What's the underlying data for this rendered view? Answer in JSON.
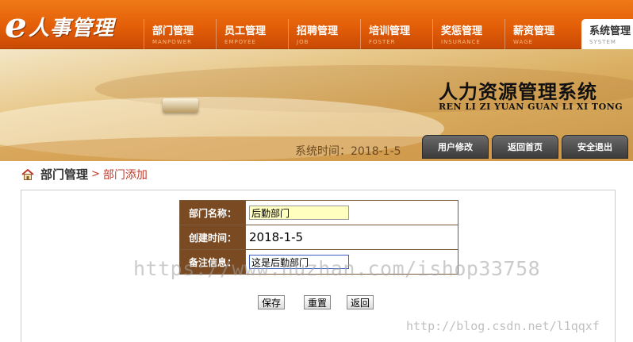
{
  "app": {
    "logo_letter": "e",
    "logo_text": "人事管理",
    "title": "人力资源管理系统",
    "subtitle": "REN LI ZI YUAN GUAN LI XI TONG"
  },
  "nav": [
    {
      "label": "部门管理",
      "sub": "MANPOWER"
    },
    {
      "label": "员工管理",
      "sub": "EMPOYEE"
    },
    {
      "label": "招聘管理",
      "sub": "JOB"
    },
    {
      "label": "培训管理",
      "sub": "FOSTER"
    },
    {
      "label": "奖惩管理",
      "sub": "INSURANCE"
    },
    {
      "label": "薪资管理",
      "sub": "WAGE"
    },
    {
      "label": "系统管理",
      "sub": "SYSTEM",
      "active": true
    }
  ],
  "header": {
    "time_text": "系统时间：2018-1-5",
    "buttons": [
      "用户修改",
      "返回首页",
      "安全退出"
    ]
  },
  "breadcrumb": {
    "section": "部门管理",
    "separator": ">",
    "page": "部门添加"
  },
  "form": {
    "rows": [
      {
        "label": "部门名称：",
        "value": "后勤部门"
      },
      {
        "label": "创建时间：",
        "value": "2018-1-5"
      },
      {
        "label": "备注信息：",
        "value": "这是后勤部门"
      }
    ],
    "buttons": {
      "save": "保存",
      "reset": "重置",
      "back": "返回"
    }
  },
  "watermarks": {
    "main": "https://www.huzhan.com/ishop33758",
    "corner": "http://blog.csdn.net/l1qqxf"
  },
  "colors": {
    "nav_orange": "#e35e08",
    "label_brown": "#7a4a22",
    "accent_red": "#c0392b"
  }
}
